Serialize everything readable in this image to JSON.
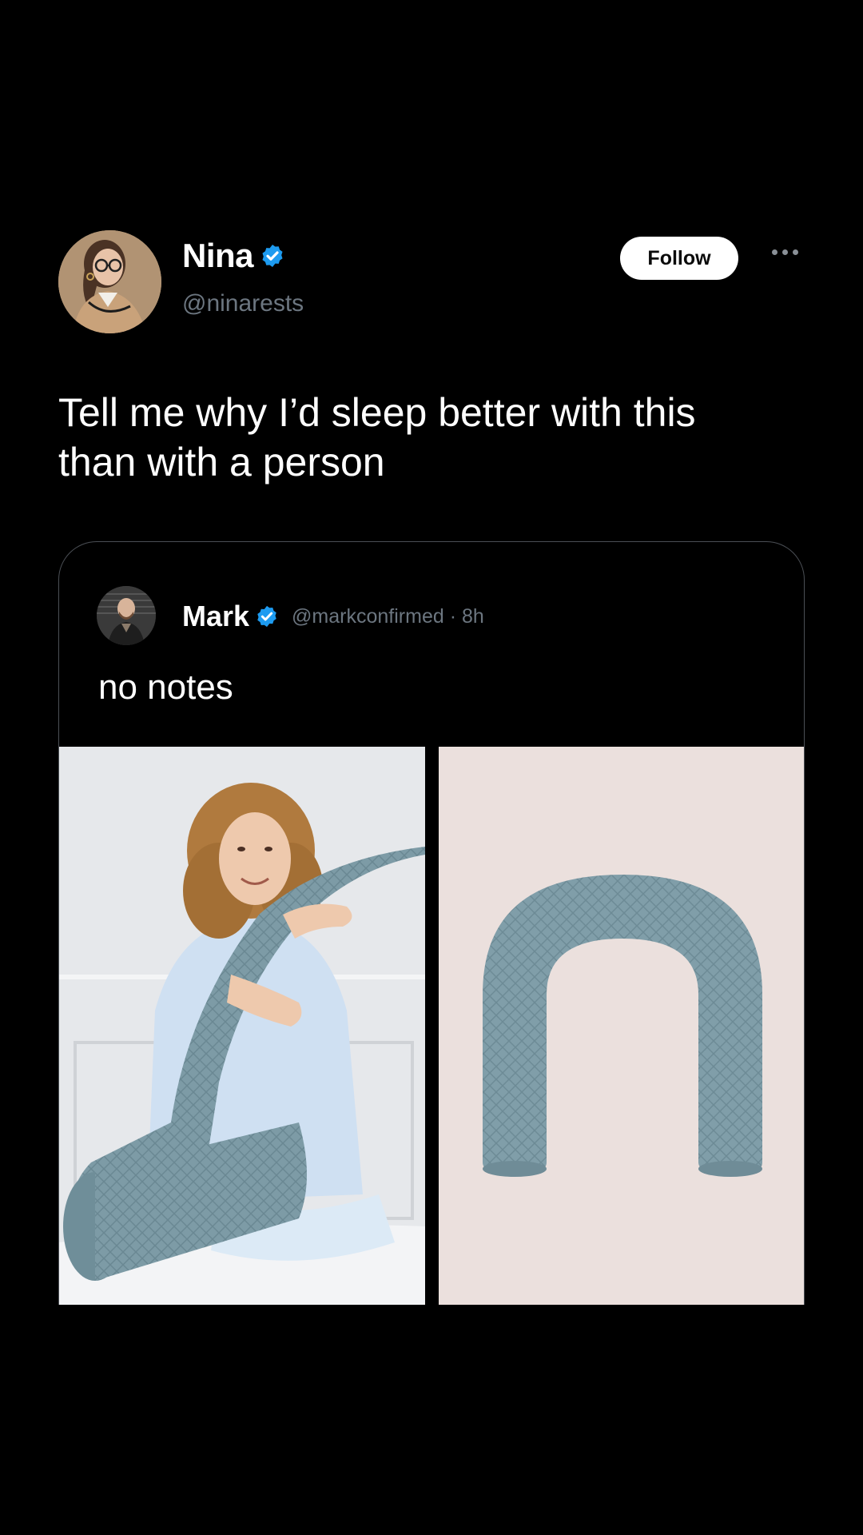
{
  "author": {
    "name": "Nina",
    "handle": "@ninarests",
    "verified": true,
    "avatar_icon": "avatar-woman-glasses"
  },
  "actions": {
    "follow_label": "Follow",
    "more_icon": "more-dots-icon"
  },
  "tweet": {
    "text": "Tell me why I’d sleep better with this than with a person"
  },
  "quoted": {
    "name": "Mark",
    "handle": "@markconfirmed",
    "time": "8h",
    "meta": "@markconfirmed · 8h",
    "verified": true,
    "text": "no notes",
    "images": [
      "photo-woman-hugging-long-pillow",
      "photo-u-shaped-pillow"
    ]
  },
  "colors": {
    "background": "#000000",
    "verified_blue": "#1d9bf0",
    "muted_text": "#6c7680",
    "pillow": "#7d9ba6"
  }
}
